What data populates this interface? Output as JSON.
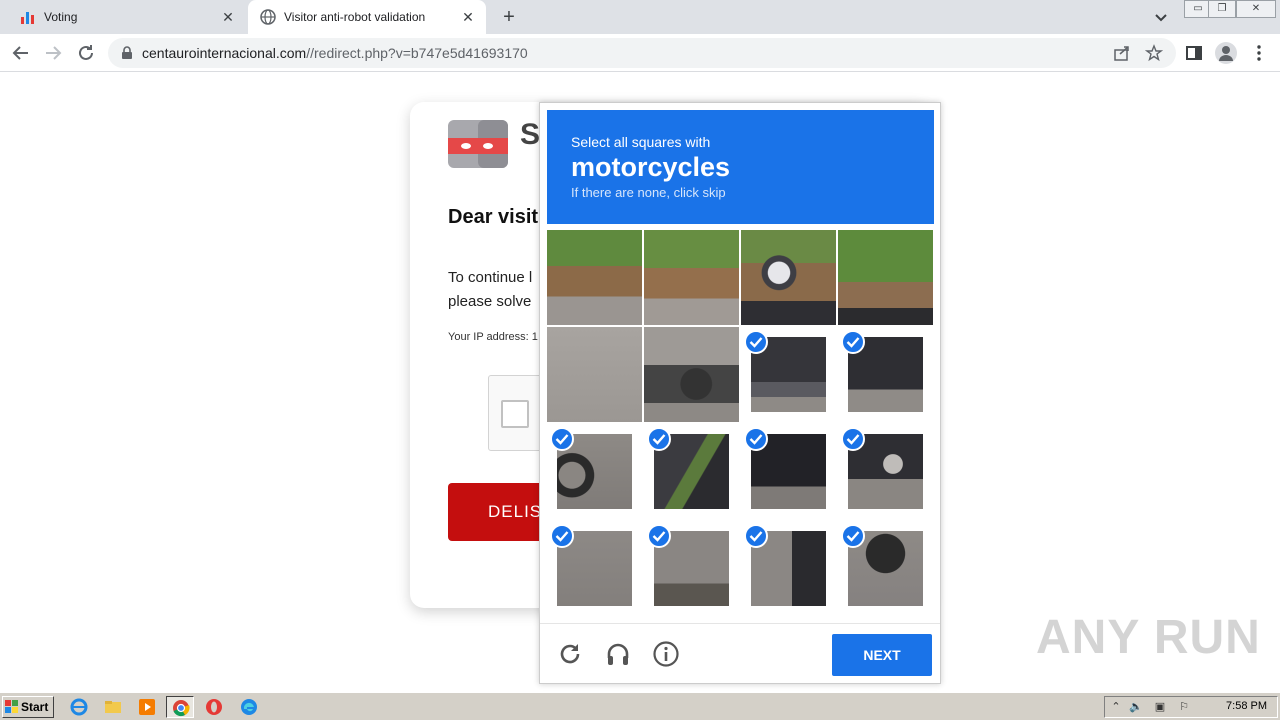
{
  "browser": {
    "tabs": [
      {
        "title": "Voting",
        "icon": "chart-favicon"
      },
      {
        "title": "Visitor anti-robot validation",
        "icon": "globe-favicon"
      }
    ],
    "new_tab": "+",
    "close_glyph": "✕",
    "url_domain": "centaurointernacional.com",
    "url_path": "//redirect.php?v=b747e5d41693170"
  },
  "page": {
    "logo_letter": "S",
    "title": "Dear visit",
    "text_line1": "To continue l",
    "text_line2": "please solve",
    "ip_label": "Your IP address: 1",
    "button_label": "DELIS"
  },
  "captcha": {
    "instruction": "Select all squares with",
    "target": "motorcycles",
    "hint": "If there are none, click skip",
    "tiles_selected": [
      false,
      false,
      false,
      false,
      false,
      false,
      true,
      true,
      true,
      true,
      true,
      true,
      true,
      true,
      true,
      true
    ],
    "next_label": "NEXT"
  },
  "watermark": "ANY RUN",
  "taskbar": {
    "start_label": "Start",
    "clock": "7:58 PM"
  },
  "colors": {
    "captcha_blue": "#1a73e8",
    "delist_red": "#c40e0e"
  }
}
